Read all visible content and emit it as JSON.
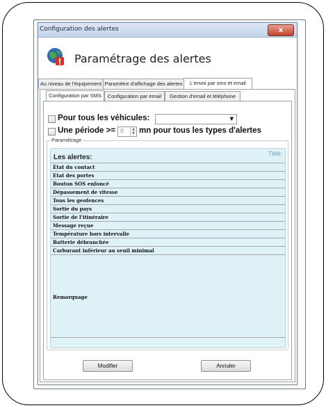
{
  "window": {
    "title": "Configuration des alertes",
    "close_label": "x"
  },
  "header": {
    "title": "Paramétrage des alertes",
    "icon": "globe-warning-icon"
  },
  "tabs_main": [
    {
      "label": "Au niveau de l'équipement",
      "active": false
    },
    {
      "label": "Paramètre d'affichage des alertes",
      "active": false
    },
    {
      "label": "L'envoi par sms et email",
      "active": true
    }
  ],
  "tabs_sub": [
    {
      "label": "Configuration par SMS",
      "active": true
    },
    {
      "label": "Configuration par email",
      "active": false
    },
    {
      "label": "Gestion d'email et téléphone",
      "active": false
    }
  ],
  "options": {
    "all_vehicles_label": "Pour tous les véhicules:",
    "all_vehicles_selected": "",
    "period_label_prefix": "Une période >=",
    "period_value": "0",
    "period_label_suffix": "mn pour tous les types d'alertes"
  },
  "settings": {
    "legend": "Paramétrage",
    "grid_header": "Les alertes:",
    "column_header": "Télé:",
    "alerts": [
      "Etat du contact",
      "Etat des portes",
      "Bouton SOS enfoncé",
      "Dépassement de vitesse",
      "Tous les geofences",
      "Sortie du pays",
      "Sortie de l'itinéraire",
      "Message reçue",
      "Température hors intervalle",
      "Batterie débranchée",
      "Carburant inférieur au seuil minimal",
      "Remorquage"
    ]
  },
  "buttons": {
    "modify": "Modifier",
    "cancel": "Annuler"
  },
  "colors": {
    "grid_bg": "#dff2f8",
    "column_header": "#6a9fd8",
    "titlebar": "#c3d4ea"
  }
}
